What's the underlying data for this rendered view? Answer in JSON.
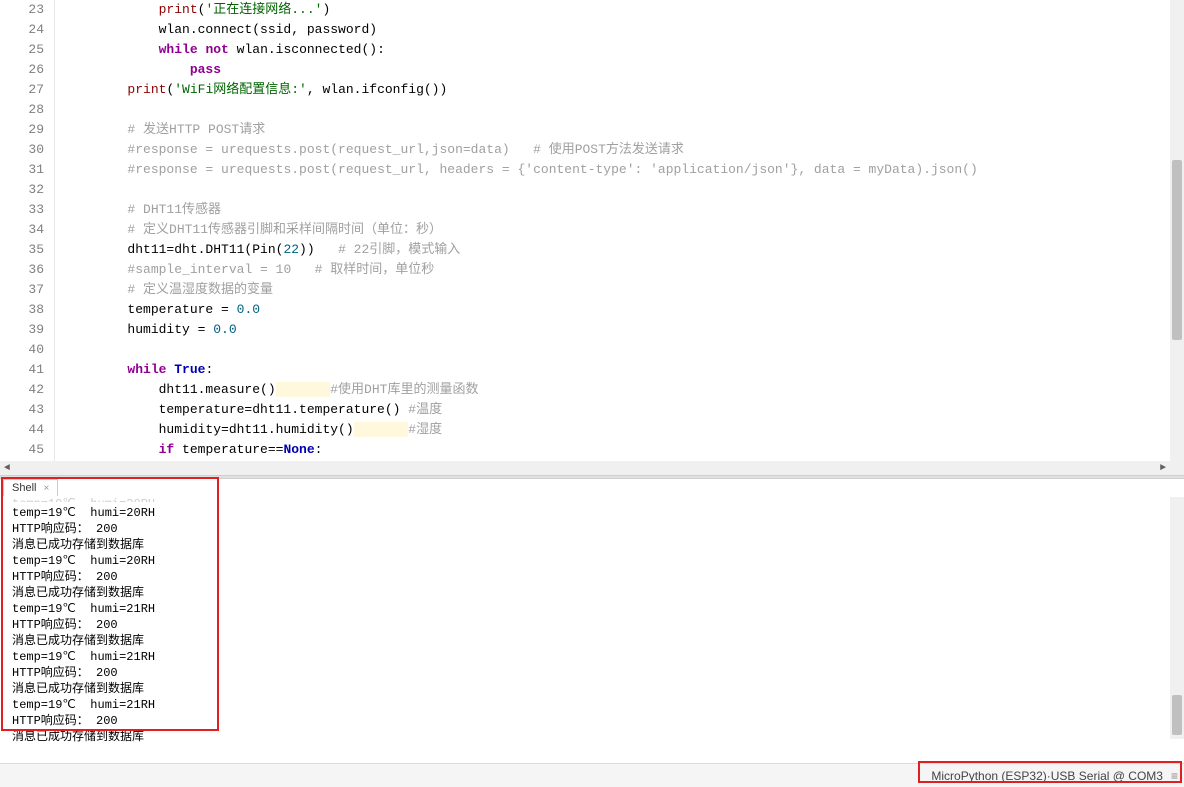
{
  "editor": {
    "first_line": 23,
    "lines": [
      {
        "n": 23,
        "html": "            <span class='fn'>print</span>(<span class='str'>'正在连接网络...'</span>)"
      },
      {
        "n": 24,
        "html": "            wlan.connect(ssid, password)"
      },
      {
        "n": 25,
        "html": "            <span class='kw'>while</span> <span class='kw'>not</span> wlan.isconnected():"
      },
      {
        "n": 26,
        "html": "                <span class='kw'>pass</span>"
      },
      {
        "n": 27,
        "html": "        <span class='fn'>print</span>(<span class='str'>'WiFi网络配置信息:'</span>, wlan.ifconfig())"
      },
      {
        "n": 28,
        "html": ""
      },
      {
        "n": 29,
        "html": "        <span class='cm'># 发送HTTP POST请求</span>"
      },
      {
        "n": 30,
        "html": "        <span class='cm'>#response = urequests.post(request_url,json=data)   # 使用POST方法发送请求</span>"
      },
      {
        "n": 31,
        "html": "        <span class='cm'>#response = urequests.post(request_url, headers = {'content-type': 'application/json'}, data = myData).json()</span>"
      },
      {
        "n": 32,
        "html": ""
      },
      {
        "n": 33,
        "html": "        <span class='cm'># DHT11传感器</span>"
      },
      {
        "n": 34,
        "html": "        <span class='cm'># 定义DHT11传感器引脚和采样间隔时间（单位：秒）</span>"
      },
      {
        "n": 35,
        "html": "        dht11=dht.DHT11(Pin(<span class='num'>22</span>))   <span class='cm'># 22引脚，模式输入</span>"
      },
      {
        "n": 36,
        "html": "        <span class='cm'>#sample_interval = 10   # 取样时间，单位秒</span>"
      },
      {
        "n": 37,
        "html": "        <span class='cm'># 定义温湿度数据的变量</span>"
      },
      {
        "n": 38,
        "html": "        temperature = <span class='num'>0.0</span>"
      },
      {
        "n": 39,
        "html": "        humidity = <span class='num'>0.0</span>"
      },
      {
        "n": 40,
        "html": ""
      },
      {
        "n": 41,
        "html": "        <span class='kw'>while</span> <span class='kwb'>True</span>:"
      },
      {
        "n": 42,
        "html": "            dht11.measure()<span class='hl'>       </span><span class='cm'>#使用DHT库里的测量函数</span>"
      },
      {
        "n": 43,
        "html": "            temperature=dht11.temperature() <span class='cm'>#温度</span>"
      },
      {
        "n": 44,
        "html": "            humidity=dht11.humidity()<span class='hl'>       </span><span class='cm'>#湿度</span>"
      },
      {
        "n": 45,
        "html": "            <span class='kw'>if</span> temperature==<span class='kwb'>None</span>:"
      }
    ]
  },
  "shell": {
    "tab_label": "Shell",
    "output": [
      "temp=19℃  humi=20RH",
      "HTTP响应码： 200",
      "消息已成功存储到数据库",
      "temp=19℃  humi=20RH",
      "HTTP响应码： 200",
      "消息已成功存储到数据库",
      "temp=19℃  humi=21RH",
      "HTTP响应码： 200",
      "消息已成功存储到数据库",
      "temp=19℃  humi=21RH",
      "HTTP响应码： 200",
      "消息已成功存储到数据库",
      "temp=19℃  humi=21RH",
      "HTTP响应码： 200",
      "消息已成功存储到数据库"
    ]
  },
  "status": {
    "interpreter": "MicroPython (ESP32)",
    "separator": " · ",
    "port": "USB Serial @ COM3"
  }
}
